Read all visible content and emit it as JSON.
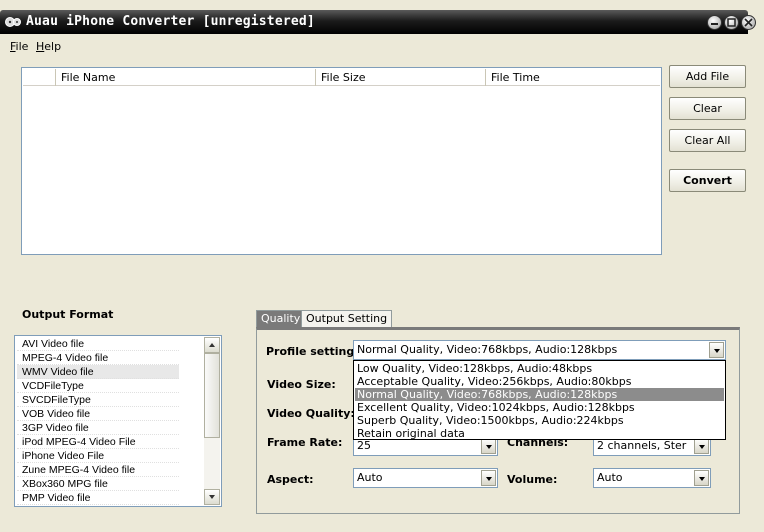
{
  "window": {
    "title": "Auau iPhone Converter  [unregistered]"
  },
  "menu": [
    {
      "label": "File",
      "mnemonic": "F",
      "rest": "ile"
    },
    {
      "label": "Help",
      "mnemonic": "H",
      "rest": "elp"
    }
  ],
  "file_table": {
    "columns": [
      "",
      "File Name",
      "File Size",
      "File Time"
    ],
    "rows": []
  },
  "buttons": {
    "add_file": "Add File",
    "clear": "Clear",
    "clear_all": "Clear All",
    "convert": "Convert"
  },
  "output_format": {
    "label": "Output Format",
    "items": [
      "AVI Video file",
      "MPEG-4 Video file",
      "WMV Video file",
      "VCDFileType",
      "SVCDFileType",
      "VOB Video file",
      "3GP Video file",
      "iPod MPEG-4 Video File",
      "iPhone Video File",
      "Zune MPEG-4 Video file",
      "XBox360 MPG file",
      "PMP Video file"
    ],
    "selected_index": 2
  },
  "tabs": [
    "Quality",
    "Output Setting"
  ],
  "active_tab": 0,
  "settings": {
    "profile_label": "Profile setting:",
    "profile_value": "Normal Quality, Video:768kbps, Audio:128kbps",
    "video_size_label": "Video Size:",
    "video_quality_label": "Video Quality:",
    "frame_rate_label": "Frame Rate:",
    "frame_rate_value": "25",
    "channels_label": "Channels:",
    "channels_value": "2 channels, Ster",
    "aspect_label": "Aspect:",
    "aspect_value": "Auto",
    "volume_label": "Volume:",
    "volume_value": "Auto"
  },
  "profile_options": [
    "Low Quality, Video:128kbps, Audio:48kbps",
    "Acceptable Quality, Video:256kbps, Audio:80kbps",
    "Normal Quality, Video:768kbps, Audio:128kbps",
    "Excellent Quality, Video:1024kbps, Audio:128kbps",
    "Superb Quality, Video:1500kbps, Audio:224kbps",
    "Retain original data"
  ],
  "profile_highlighted_index": 2
}
